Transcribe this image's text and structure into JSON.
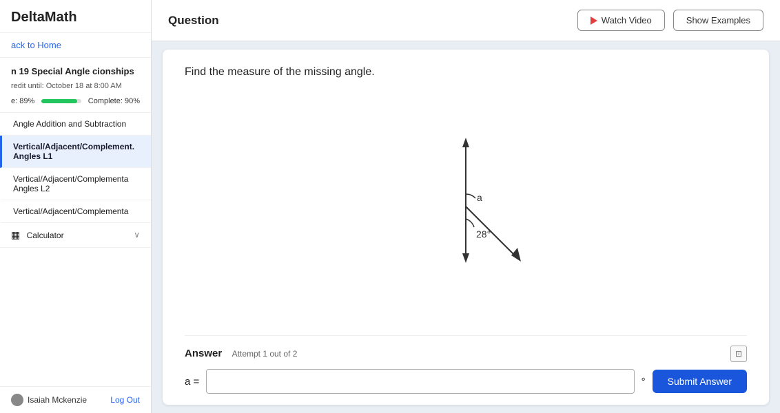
{
  "app": {
    "logo": "DeltaMath"
  },
  "sidebar": {
    "back_label": "ack to Home",
    "section_title": "n 19 Special Angle\ncionships",
    "credit_label": "redit until: October 18 at 8:00 AM",
    "progress_score": "e: 89%",
    "progress_complete": "Complete: 90%",
    "nav_items": [
      {
        "label": "Angle Addition and Subtraction",
        "active": false
      },
      {
        "label": "Vertical/Adjacent/Complement.\nAngles L1",
        "active": true
      },
      {
        "label": "Vertical/Adjacent/Complementa\nAngles L2",
        "active": false
      },
      {
        "label": "Vertical/Adjacent/Complementa",
        "active": false
      }
    ],
    "calculator_label": "Calculator",
    "user_name": "Isaiah Mckenzie",
    "logout_label": "Log Out"
  },
  "header": {
    "title": "Question",
    "watch_video_label": "Watch Video",
    "show_examples_label": "Show Examples"
  },
  "main": {
    "question_text": "Find the measure of the missing angle.",
    "diagram": {
      "angle_a_label": "a",
      "angle_28_label": "28°"
    },
    "answer": {
      "label": "Answer",
      "attempt_label": "Attempt 1 out of 2",
      "eq": "a =",
      "input_placeholder": "",
      "degree": "°",
      "submit_label": "Submit Answer"
    }
  }
}
